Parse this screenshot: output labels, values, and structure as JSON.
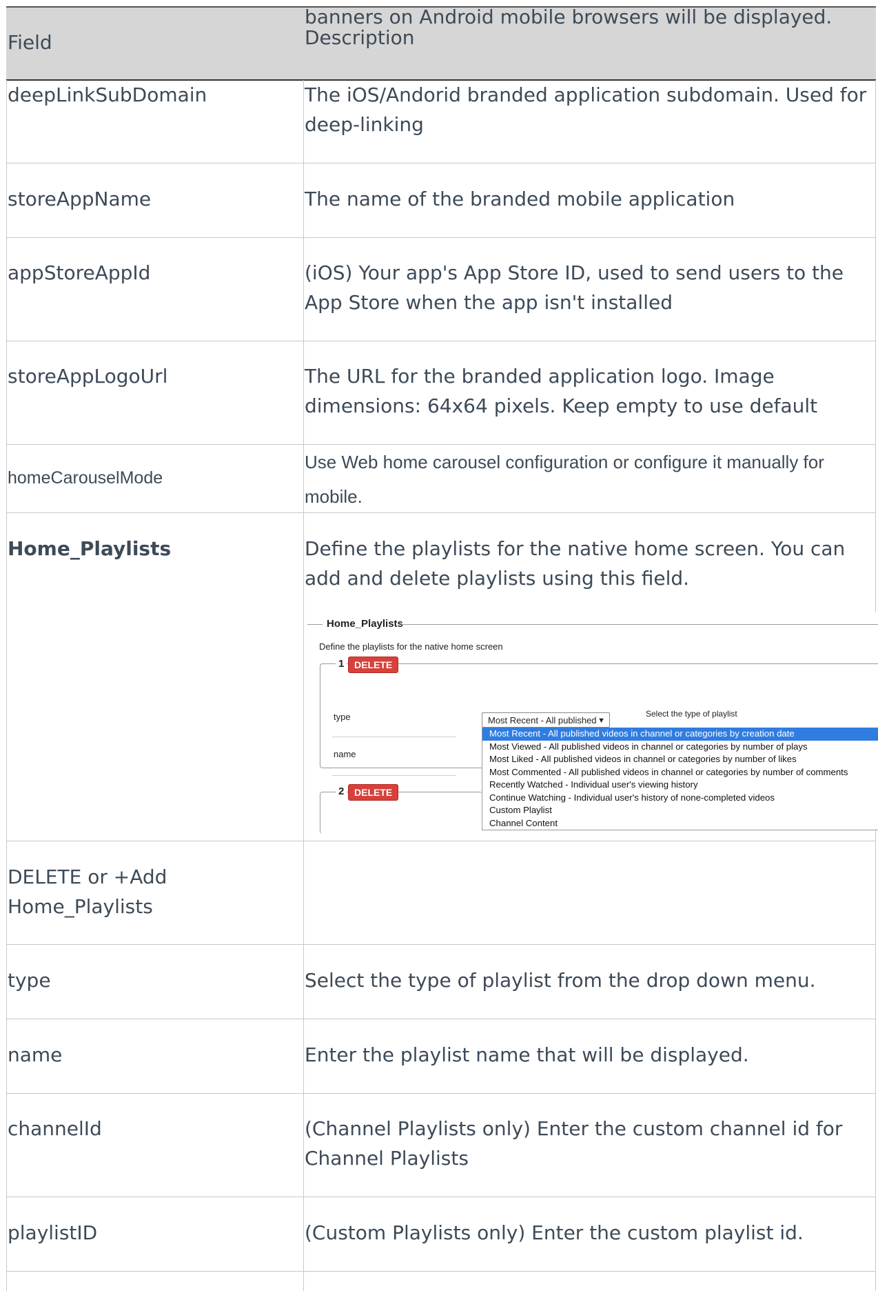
{
  "header": {
    "field_label": "Field",
    "overflow_text": "banners on Android mobile browsers will be displayed.",
    "description_label": "Description"
  },
  "rows": [
    {
      "field": "deepLinkSubDomain",
      "description": "The iOS/Andorid branded application subdomain. Used for deep-linking"
    },
    {
      "field": "storeAppName",
      "description": "The name of the branded mobile application"
    },
    {
      "field": "appStoreAppId",
      "description": "(iOS) Your app's App Store ID, used to send users to the App Store when the app isn't installed"
    },
    {
      "field": "storeAppLogoUrl",
      "description": "The URL for the branded application logo. Image dimensions: 64x64 pixels. Keep empty to use default"
    },
    {
      "field": "homeCarouselMode",
      "description": "Use Web home carousel configuration or configure it manually for mobile."
    },
    {
      "field": "Home_Playlists",
      "description": "Define the playlists for the native home screen. You can add and delete playlists using this field."
    },
    {
      "field": "DELETE or +Add Home_Playlists",
      "description": ""
    },
    {
      "field": "type",
      "description": "Select the type of playlist from the drop down menu."
    },
    {
      "field": "name",
      "description": "Enter the playlist name that will be displayed."
    },
    {
      "field": "channelId",
      "description": "(Channel Playlists only) Enter the custom channel id for Channel Playlists"
    },
    {
      "field": "playlistID",
      "description": "(Custom Playlists only) Enter the custom playlist id."
    }
  ],
  "embedded_form": {
    "fieldset_title": "Home_Playlists",
    "fieldset_hint": "Define the playlists for the native home screen",
    "item1_number": "1",
    "item2_number": "2",
    "delete_label": "DELETE",
    "type_label": "type",
    "name_label": "name",
    "type_select_value": "Most Recent - All published ",
    "type_hint": "Select the type of playlist",
    "options": [
      "Most Recent - All published videos in channel or categories by creation date",
      "Most Viewed - All published videos in channel or categories by number of plays",
      "Most Liked - All published videos in channel or categories by number of likes",
      "Most Commented - All published videos in channel or categories by number of comments",
      "Recently Watched - Individual user's viewing history",
      "Continue Watching - Individual user's history of none-completed videos",
      "Custom Playlist",
      "Channel Content"
    ],
    "selected_option_index": 0
  }
}
